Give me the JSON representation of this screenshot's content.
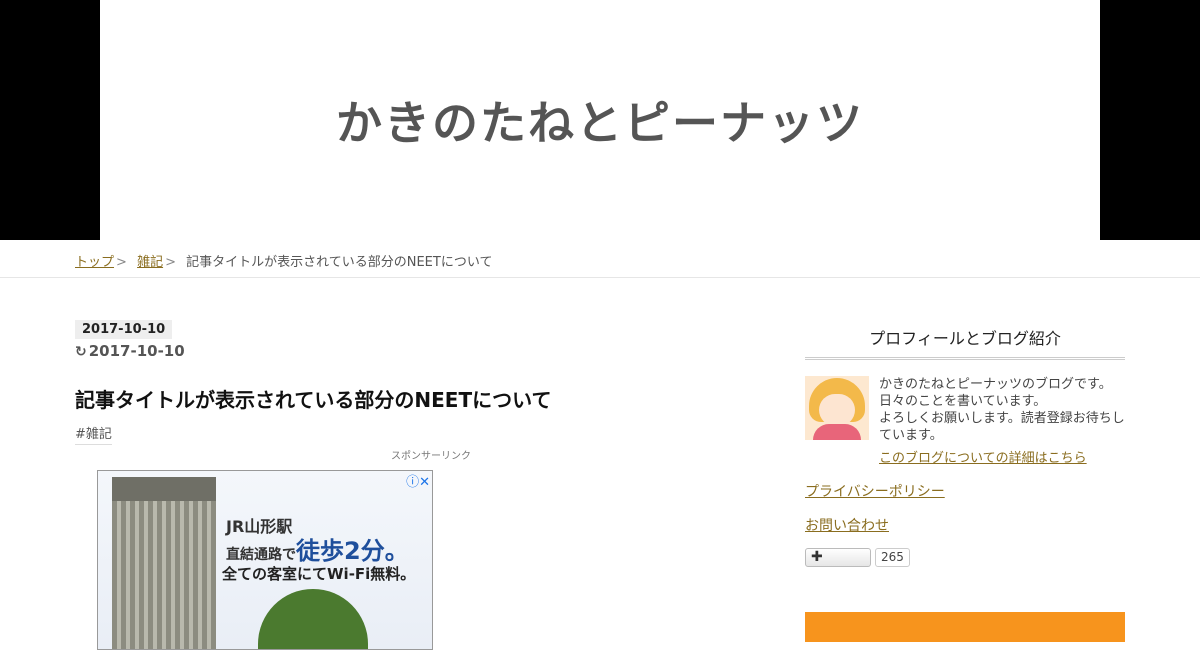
{
  "header": {
    "site_title": "かきのたねとピーナッツ"
  },
  "breadcrumb": [
    {
      "label": "トップ"
    },
    {
      "label": "雑記"
    },
    {
      "label": "記事タイトルが表示されている部分のNEETについて"
    }
  ],
  "breadcrumb_separator": ">",
  "entry": {
    "date": "2017-10-10",
    "updated": "2017-10-10",
    "refresh_icon": "refresh-icon",
    "title": "記事タイトルが表示されている部分のNEETについて",
    "category": "#雑記"
  },
  "ad": {
    "label": "スポンサーリンク",
    "line1": "JR山形駅",
    "line2_prefix": "直結通路で",
    "line2_emph": "徒歩2分。",
    "line3": "全ての客室にてWi-Fi無料。",
    "icons": "ⓘ✕"
  },
  "sidebar": {
    "title": "プロフィールとブログ紹介",
    "profile_text_1": "かきのたねとピーナッツのブログです。日々のことを書いています。",
    "profile_text_2": "よろしくお願いします。読者登録お待ちしています。",
    "profile_link": "このブログについての詳細はこちら",
    "link_1": "プライバシーポリシー",
    "link_2": "お問い合わせ",
    "subscribe_label": "✚",
    "subscribe_count": "265"
  },
  "colors": {
    "link": "#8a6d1f",
    "banner": "#f7941d",
    "header_bg": "#000000"
  }
}
